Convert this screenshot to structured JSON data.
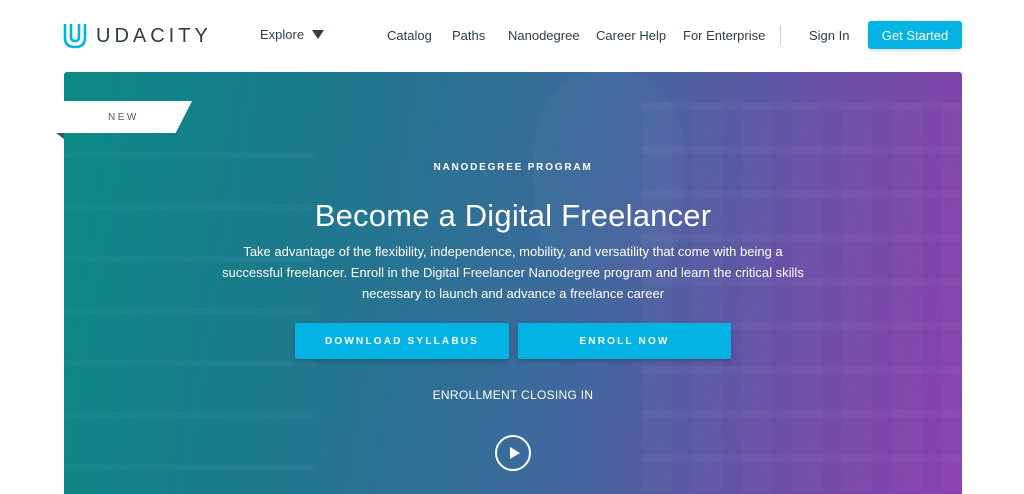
{
  "header": {
    "brand": "UDACITY",
    "explore_label": "Explore",
    "nav": [
      "Catalog",
      "Paths",
      "Nanodegree",
      "Career Help",
      "For Enterprise"
    ],
    "sign_in": "Sign In",
    "get_started": "Get Started"
  },
  "hero": {
    "badge": "NEW",
    "eyebrow": "NANODEGREE PROGRAM",
    "title": "Become a Digital Freelancer",
    "description": "Take advantage of the flexibility, independence, mobility, and versatility that come with being a successful freelancer. Enroll in the Digital Freelancer Nanodegree program and learn the critical skills necessary to launch and advance a freelance career",
    "download_label": "DOWNLOAD SYLLABUS",
    "enroll_label": "ENROLL NOW",
    "closing_label": "ENROLLMENT CLOSING IN"
  },
  "colors": {
    "accent": "#02b3e4",
    "text_dark": "#2e3d49"
  }
}
